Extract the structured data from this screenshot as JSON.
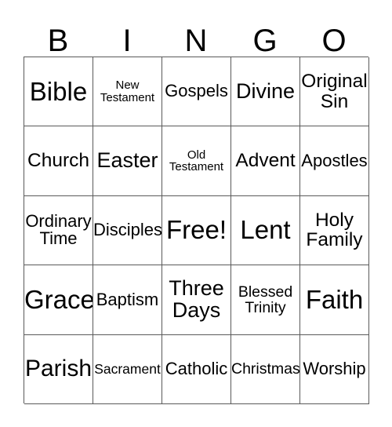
{
  "card": {
    "header": {
      "letters": [
        "B",
        "I",
        "N",
        "G",
        "O"
      ]
    },
    "free_space_label": "Free!",
    "rows": [
      [
        {
          "label": "Bible",
          "size": "xxl"
        },
        {
          "label": "New Testament",
          "size": "xs"
        },
        {
          "label": "Gospels",
          "size": "m"
        },
        {
          "label": "Divine",
          "size": "l"
        },
        {
          "label": "Original Sin",
          "size": "ml"
        }
      ],
      [
        {
          "label": "Church",
          "size": "ml"
        },
        {
          "label": "Easter",
          "size": "l"
        },
        {
          "label": "Old Testament",
          "size": "xs"
        },
        {
          "label": "Advent",
          "size": "ml"
        },
        {
          "label": "Apostles",
          "size": "m"
        }
      ],
      [
        {
          "label": "Ordinary Time",
          "size": "m"
        },
        {
          "label": "Disciples",
          "size": "m"
        },
        {
          "label": "Free!",
          "size": "xxl"
        },
        {
          "label": "Lent",
          "size": "xxl"
        },
        {
          "label": "Holy Family",
          "size": "ml"
        }
      ],
      [
        {
          "label": "Grace",
          "size": "xxl"
        },
        {
          "label": "Baptism",
          "size": "m"
        },
        {
          "label": "Three Days",
          "size": "l"
        },
        {
          "label": "Blessed Trinity",
          "size": "sm"
        },
        {
          "label": "Faith",
          "size": "xxl"
        }
      ],
      [
        {
          "label": "Parish",
          "size": "xl"
        },
        {
          "label": "Sacrament",
          "size": "s"
        },
        {
          "label": "Catholic",
          "size": "m"
        },
        {
          "label": "Christmas",
          "size": "sm"
        },
        {
          "label": "Worship",
          "size": "m"
        }
      ]
    ],
    "colors": {
      "background": "#ffffff",
      "text": "#000000",
      "grid_line": "#5a5a5a"
    }
  }
}
